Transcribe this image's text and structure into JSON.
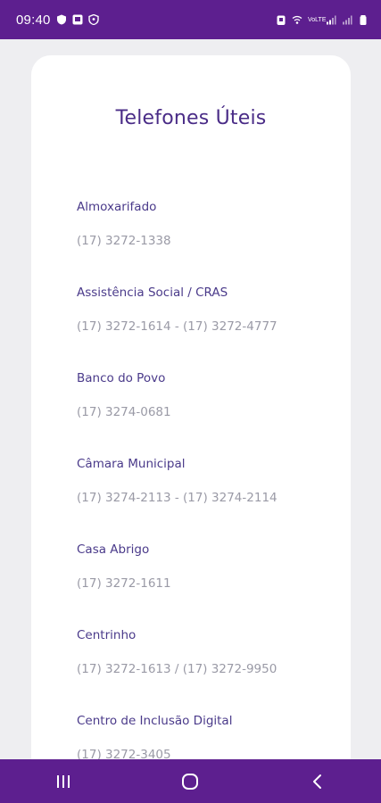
{
  "status_bar": {
    "time": "09:40",
    "network_label": "VoLTE",
    "background": "#5d1f8f",
    "icons_left": [
      "shield-icon",
      "notification-box-icon",
      "vpn-shield-icon"
    ],
    "icons_right": [
      "alarm-icon",
      "wifi-calling-icon",
      "signal-icon",
      "signal-icon",
      "battery-icon"
    ]
  },
  "page": {
    "title": "Telefones Úteis",
    "title_color": "#4a2c87",
    "name_color": "#4a3a8a",
    "phone_color": "#9a9aa6"
  },
  "contacts": [
    {
      "name": "Almoxarifado",
      "phone": "(17) 3272-1338"
    },
    {
      "name": "Assistência Social / CRAS",
      "phone": "(17) 3272-1614 - (17) 3272-4777"
    },
    {
      "name": "Banco do Povo",
      "phone": "(17) 3274-0681"
    },
    {
      "name": "Câmara Municipal",
      "phone": "(17) 3274-2113 - (17) 3274-2114"
    },
    {
      "name": "Casa Abrigo",
      "phone": "(17) 3272-1611"
    },
    {
      "name": "Centrinho",
      "phone": "(17) 3272-1613 / (17) 3272-9950"
    },
    {
      "name": "Centro de Inclusão Digital",
      "phone": "(17) 3272-3405"
    }
  ],
  "nav_bar": {
    "buttons": [
      "recent-apps-icon",
      "home-icon",
      "back-icon"
    ]
  }
}
